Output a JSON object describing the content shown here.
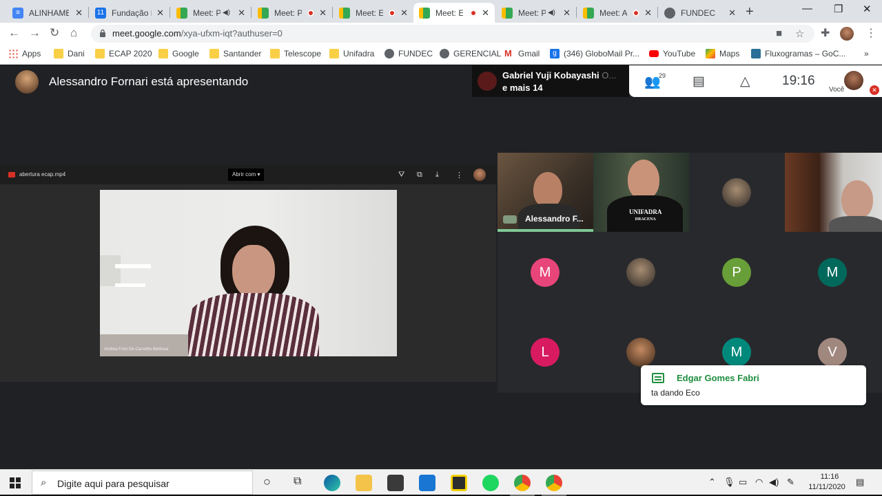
{
  "browser": {
    "tabs": [
      {
        "title": "ALINHAMEN",
        "icon": "docs-icon",
        "color": "#4285f4",
        "glyph": "≡"
      },
      {
        "title": "Fundação D",
        "icon": "calendar-icon",
        "color": "#1a73e8",
        "glyph": "11"
      },
      {
        "title": "Meet: P",
        "icon": "meet-icon",
        "sound": true
      },
      {
        "title": "Meet: P",
        "icon": "meet-icon",
        "recording": true
      },
      {
        "title": "Meet: E",
        "icon": "meet-icon",
        "recording": true
      },
      {
        "title": "Meet: E",
        "icon": "meet-icon",
        "recording": true,
        "active": true
      },
      {
        "title": "Meet: P",
        "icon": "meet-icon",
        "sound": true
      },
      {
        "title": "Meet: A",
        "icon": "meet-icon",
        "recording": true
      },
      {
        "title": "FUNDEC",
        "icon": "globe-icon",
        "color": "#5f6368",
        "glyph": ""
      }
    ],
    "url_host": "meet.google.com",
    "url_path": "/xya-ufxm-iqt?authuser=0",
    "bookmarks": [
      "Apps",
      "Dani",
      "ECAP 2020",
      "Google",
      "Santander",
      "Telescope",
      "Unifadra",
      "FUNDEC",
      "GERENCIAL",
      "Gmail",
      "(346) GloboMail Pr...",
      "YouTube",
      "Maps",
      "Fluxogramas – GoC..."
    ]
  },
  "meet": {
    "presenting_text": "Alessandro Fornari está apresentando",
    "speaker_name": "Gabriel Yuji Kobayashi",
    "speaker_fade": "O...",
    "speaker_more": "e mais 14",
    "participant_count": "29",
    "time": "19:16",
    "self_label": "Você",
    "shared_file": "abertura ecap.mp4",
    "open_with": "Abrir com",
    "video_caption": "Andrea Frizo De Carvalho Barbosa",
    "tiles": [
      {
        "name": "Alessandro F...",
        "kind": "video"
      },
      {
        "shirt_line1": "UNIFADRA",
        "shirt_line2": "DRACENA",
        "kind": "video"
      },
      {
        "kind": "photo"
      },
      {
        "kind": "video"
      },
      {
        "initial": "M",
        "color": "#e8457a"
      },
      {
        "kind": "photo"
      },
      {
        "initial": "P",
        "color": "#689f38"
      },
      {
        "initial": "M",
        "color": "#00695c"
      },
      {
        "initial": "L",
        "color": "#d81b60"
      },
      {
        "kind": "photo"
      },
      {
        "initial": "M",
        "color": "#00897b"
      },
      {
        "initial": "V",
        "color": "#a1887f"
      }
    ],
    "chat_toast": {
      "name": "Edgar Gomes Fabri",
      "message": "ta dando Eco"
    }
  },
  "taskbar": {
    "search_placeholder": "Digite aqui para pesquisar",
    "time": "11:16",
    "date": "11/11/2020"
  }
}
